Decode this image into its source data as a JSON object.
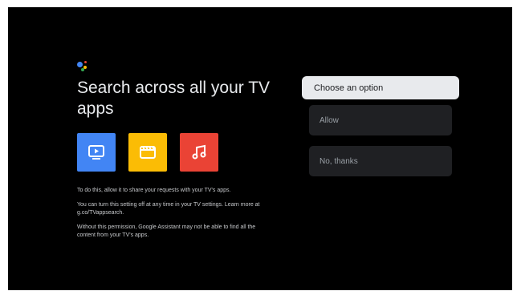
{
  "screen": {
    "title": "Search across all your TV apps",
    "app_icons": [
      {
        "name": "play-icon",
        "color": "#4285f4"
      },
      {
        "name": "clapperboard-icon",
        "color": "#fbbc05"
      },
      {
        "name": "music-note-icon",
        "color": "#ea4335"
      }
    ],
    "body": {
      "p1": "To do this, allow it to share your requests with your TV's apps.",
      "p2": "You can turn this setting off at any time in your TV settings. Learn more at g.co/TVappsearch.",
      "p3": "Without this permission, Google Assistant may not be able to find all the content from your TV's apps."
    }
  },
  "options": {
    "header": "Choose an option",
    "allow": "Allow",
    "no_thanks": "No, thanks"
  },
  "colors": {
    "background": "#000000",
    "focused_option": "#e8eaed",
    "option": "#1f2023",
    "assistant_blue": "#4285f4",
    "assistant_red": "#ea4335",
    "assistant_yellow": "#fbbc05",
    "assistant_green": "#34a853"
  }
}
